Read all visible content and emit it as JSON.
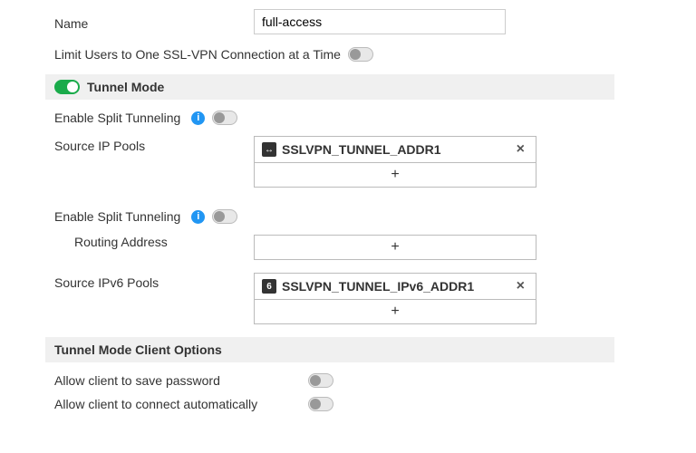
{
  "nameSection": {
    "label": "Name",
    "value": "full-access"
  },
  "limitUsers": {
    "label": "Limit Users to One SSL-VPN Connection at a Time",
    "enabled": false
  },
  "tunnelMode": {
    "header": "Tunnel Mode",
    "enabled": true,
    "splitTunneling1": {
      "label": "Enable Split Tunneling",
      "enabled": false
    },
    "sourceIpPools": {
      "label": "Source IP Pools",
      "items": [
        "SSLVPN_TUNNEL_ADDR1"
      ]
    },
    "splitTunneling2": {
      "label": "Enable Split Tunneling",
      "enabled": false
    },
    "routingAddress": {
      "label": "Routing Address"
    },
    "sourceIpv6Pools": {
      "label": "Source IPv6 Pools",
      "items": [
        "SSLVPN_TUNNEL_IPv6_ADDR1"
      ]
    }
  },
  "clientOptions": {
    "header": "Tunnel Mode Client Options",
    "savePassword": {
      "label": "Allow client to save password",
      "enabled": false
    },
    "autoConnect": {
      "label": "Allow client to connect automatically",
      "enabled": false
    }
  },
  "glyphs": {
    "info": "i",
    "plus": "+",
    "x": "×",
    "addr4": "↔",
    "addr6": "6"
  }
}
